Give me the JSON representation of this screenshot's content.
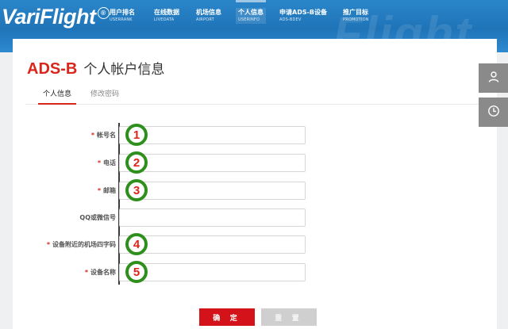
{
  "header": {
    "logo": "VariFlight",
    "logo_badge": "®",
    "watermark": "Flight",
    "nav": [
      {
        "zh": "用户排名",
        "en": "USERRANK"
      },
      {
        "zh": "在线数据",
        "en": "LIVEDATA"
      },
      {
        "zh": "机场信息",
        "en": "AIRPORT"
      },
      {
        "zh": "个人信息",
        "en": "USERINFO"
      },
      {
        "zh": "申请ADS-B设备",
        "en": "ADS-BDEV"
      },
      {
        "zh": "推广目标",
        "en": "PROMOTION"
      }
    ],
    "active_nav_index": 3
  },
  "page": {
    "brand": "ADS-B",
    "title": "个人帐户信息",
    "tabs": [
      {
        "label": "个人信息",
        "active": true
      },
      {
        "label": "修改密码",
        "active": false
      }
    ]
  },
  "form": {
    "required_mark": "*",
    "fields": [
      {
        "label": "帐号名",
        "required": true,
        "value": "",
        "marker": "1"
      },
      {
        "label": "电话",
        "required": true,
        "value": "",
        "marker": "2"
      },
      {
        "label": "邮箱",
        "required": true,
        "value": "",
        "marker": "3"
      },
      {
        "label": "QQ或微信号",
        "required": false,
        "value": "",
        "marker": ""
      },
      {
        "label": "设备附近的机场四字码",
        "required": true,
        "value": "",
        "marker": "4"
      },
      {
        "label": "设备名称",
        "required": true,
        "value": "",
        "marker": "5"
      }
    ],
    "submit_label": "确 定",
    "reset_label": "重 置"
  },
  "sidebar": {
    "buttons": [
      {
        "icon": "user-icon"
      },
      {
        "icon": "clock-icon"
      }
    ]
  },
  "colors": {
    "header_blue": "#1f74b8",
    "brand_red": "#d9261c",
    "submit_red": "#d4121a",
    "marker_green": "#2f8f1c",
    "marker_red": "#e2231a",
    "side_gray": "#8a8a8a"
  }
}
